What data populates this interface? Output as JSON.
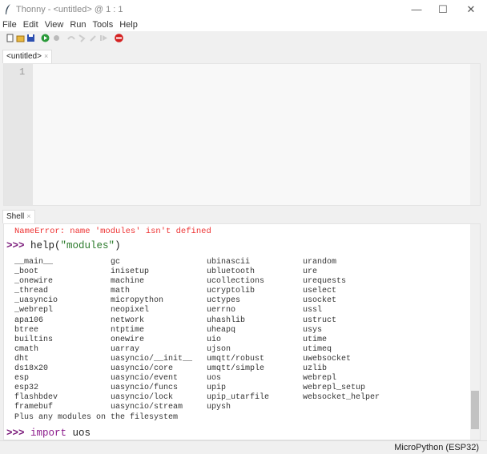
{
  "window": {
    "title": "Thonny  -  <untitled>  @  1 : 1",
    "minimize": "—",
    "maximize": "☐",
    "close": "✕"
  },
  "menu": [
    "File",
    "Edit",
    "View",
    "Run",
    "Tools",
    "Help"
  ],
  "toolbar": [
    "new-file",
    "open-file",
    "save",
    "run",
    "debug",
    "step-over",
    "step-into",
    "step-out",
    "resume",
    "stop"
  ],
  "editor": {
    "tab": "<untitled>",
    "tab_close": "×",
    "line_numbers": [
      "1"
    ]
  },
  "shell": {
    "tab": "Shell",
    "tab_close": "×",
    "error": "NameError: name 'modules' isn't defined",
    "prompt": ">>>",
    "cmd1": {
      "func": "help(",
      "arg": "\"modules\"",
      "close": ")"
    },
    "modules": [
      [
        "__main__",
        "gc",
        "ubinascii",
        "urandom"
      ],
      [
        "_boot",
        "inisetup",
        "ubluetooth",
        "ure"
      ],
      [
        "_onewire",
        "machine",
        "ucollections",
        "urequests"
      ],
      [
        "_thread",
        "math",
        "ucryptolib",
        "uselect"
      ],
      [
        "_uasyncio",
        "micropython",
        "uctypes",
        "usocket"
      ],
      [
        "_webrepl",
        "neopixel",
        "uerrno",
        "ussl"
      ],
      [
        "apa106",
        "network",
        "uhashlib",
        "ustruct"
      ],
      [
        "btree",
        "ntptime",
        "uheapq",
        "usys"
      ],
      [
        "builtins",
        "onewire",
        "uio",
        "utime"
      ],
      [
        "cmath",
        "uarray",
        "ujson",
        "utimeq"
      ],
      [
        "dht",
        "uasyncio/__init__",
        "umqtt/robust",
        "uwebsocket"
      ],
      [
        "ds18x20",
        "uasyncio/core",
        "umqtt/simple",
        "uzlib"
      ],
      [
        "esp",
        "uasyncio/event",
        "uos",
        "webrepl"
      ],
      [
        "esp32",
        "uasyncio/funcs",
        "upip",
        "webrepl_setup"
      ],
      [
        "flashbdev",
        "uasyncio/lock",
        "upip_utarfile",
        "websocket_helper"
      ],
      [
        "framebuf",
        "uasyncio/stream",
        "upysh",
        ""
      ]
    ],
    "footer": "Plus any modules on the filesystem",
    "cmd2": {
      "keyword": "import",
      "arg": " uos"
    }
  },
  "status": {
    "interpreter": "MicroPython (ESP32)"
  }
}
